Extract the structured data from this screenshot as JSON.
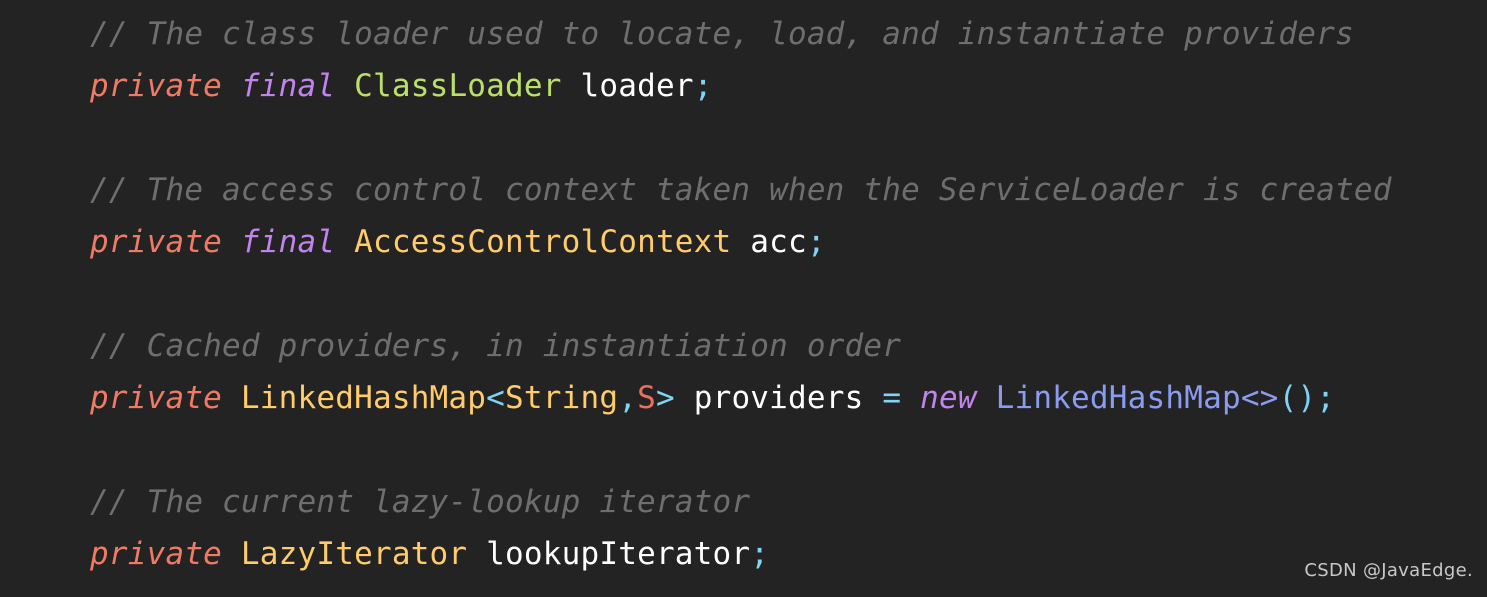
{
  "editor": {
    "background_color": "#232323",
    "language": "java",
    "font_size_px": 31,
    "line_height_px": 52
  },
  "palette": {
    "background": "#232323",
    "comment": "#6E6E6E",
    "keyword_private": "#F07A64",
    "keyword_modifier": "#C183EC",
    "type_green": "#BBE06A",
    "type_gold": "#FFCB6B",
    "generic_param": "#E8705F",
    "identifier": "#FFFFFF",
    "punctuation": "#7FD4F5",
    "constructor": "#8A9CF0",
    "watermark": "#C8C8C8"
  },
  "lines": [
    {
      "id": "line-comment-1",
      "kind": "comment",
      "tokens": [
        {
          "text": "// The class loader used to locate, load, and instantiate providers",
          "color_class": "t-comment"
        }
      ]
    },
    {
      "id": "line-code-1",
      "kind": "code",
      "tokens": [
        {
          "text": "private",
          "color_class": "t-keyword"
        },
        {
          "text": " ",
          "color_class": "t-ident"
        },
        {
          "text": "final",
          "color_class": "t-modifier"
        },
        {
          "text": " ",
          "color_class": "t-ident"
        },
        {
          "text": "ClassLoader",
          "color_class": "t-type-green"
        },
        {
          "text": " ",
          "color_class": "t-ident"
        },
        {
          "text": "loader",
          "color_class": "t-ident"
        },
        {
          "text": ";",
          "color_class": "t-punct"
        }
      ]
    },
    {
      "id": "line-blank-1",
      "kind": "blank",
      "tokens": []
    },
    {
      "id": "line-comment-2",
      "kind": "comment",
      "tokens": [
        {
          "text": "// The access control context taken when the ServiceLoader is created",
          "color_class": "t-comment"
        }
      ]
    },
    {
      "id": "line-code-2",
      "kind": "code",
      "tokens": [
        {
          "text": "private",
          "color_class": "t-keyword"
        },
        {
          "text": " ",
          "color_class": "t-ident"
        },
        {
          "text": "final",
          "color_class": "t-modifier"
        },
        {
          "text": " ",
          "color_class": "t-ident"
        },
        {
          "text": "AccessControlContext",
          "color_class": "t-type-gold"
        },
        {
          "text": " ",
          "color_class": "t-ident"
        },
        {
          "text": "acc",
          "color_class": "t-ident"
        },
        {
          "text": ";",
          "color_class": "t-punct"
        }
      ]
    },
    {
      "id": "line-blank-2",
      "kind": "blank",
      "tokens": []
    },
    {
      "id": "line-comment-3",
      "kind": "comment",
      "tokens": [
        {
          "text": "// Cached providers, in instantiation order",
          "color_class": "t-comment"
        }
      ]
    },
    {
      "id": "line-code-3",
      "kind": "code",
      "tokens": [
        {
          "text": "private",
          "color_class": "t-keyword"
        },
        {
          "text": " ",
          "color_class": "t-ident"
        },
        {
          "text": "LinkedHashMap",
          "color_class": "t-type-gold"
        },
        {
          "text": "<",
          "color_class": "t-punct"
        },
        {
          "text": "String",
          "color_class": "t-type-gold"
        },
        {
          "text": ",",
          "color_class": "t-punct"
        },
        {
          "text": "S",
          "color_class": "t-generic"
        },
        {
          "text": ">",
          "color_class": "t-punct"
        },
        {
          "text": " ",
          "color_class": "t-ident"
        },
        {
          "text": "providers",
          "color_class": "t-ident"
        },
        {
          "text": " ",
          "color_class": "t-ident"
        },
        {
          "text": "=",
          "color_class": "t-punct"
        },
        {
          "text": " ",
          "color_class": "t-ident"
        },
        {
          "text": "new",
          "color_class": "t-modifier"
        },
        {
          "text": " ",
          "color_class": "t-ident"
        },
        {
          "text": "LinkedHashMap<>",
          "color_class": "t-ctor"
        },
        {
          "text": "();",
          "color_class": "t-punct"
        }
      ]
    },
    {
      "id": "line-blank-3",
      "kind": "blank",
      "tokens": []
    },
    {
      "id": "line-comment-4",
      "kind": "comment",
      "tokens": [
        {
          "text": "// The current lazy-lookup iterator",
          "color_class": "t-comment"
        }
      ]
    },
    {
      "id": "line-code-4",
      "kind": "code",
      "tokens": [
        {
          "text": "private",
          "color_class": "t-keyword"
        },
        {
          "text": " ",
          "color_class": "t-ident"
        },
        {
          "text": "LazyIterator",
          "color_class": "t-type-gold"
        },
        {
          "text": " ",
          "color_class": "t-ident"
        },
        {
          "text": "lookupIterator",
          "color_class": "t-ident"
        },
        {
          "text": ";",
          "color_class": "t-punct"
        }
      ]
    }
  ],
  "watermark": {
    "text": "CSDN @JavaEdge."
  }
}
